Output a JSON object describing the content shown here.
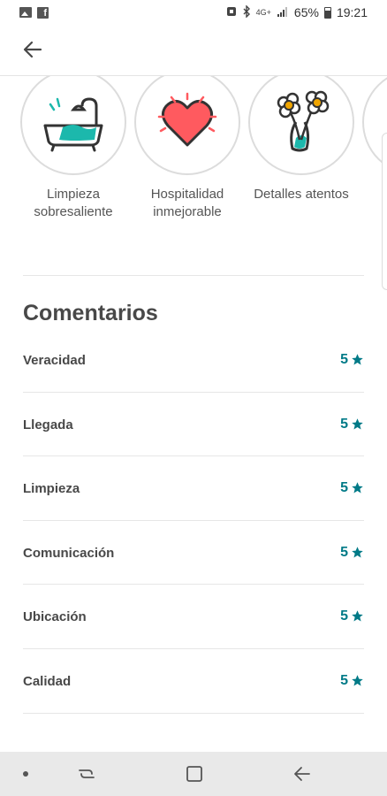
{
  "status_bar": {
    "network": "4G+",
    "battery": "65%",
    "time": "19:21"
  },
  "header": {
    "back_icon": "back-arrow-icon"
  },
  "highlights": [
    {
      "label": "Limpieza sobresaliente",
      "icon": "bathtub-icon"
    },
    {
      "label": "Hospitalidad inmejorable",
      "icon": "heart-icon"
    },
    {
      "label": "Detalles atentos",
      "icon": "flowers-vase-icon"
    }
  ],
  "comments": {
    "title": "Comentarios",
    "accent": "#007a87",
    "items": [
      {
        "label": "Veracidad",
        "value": "5"
      },
      {
        "label": "Llegada",
        "value": "5"
      },
      {
        "label": "Limpieza",
        "value": "5"
      },
      {
        "label": "Comunicación",
        "value": "5"
      },
      {
        "label": "Ubicación",
        "value": "5"
      },
      {
        "label": "Calidad",
        "value": "5"
      }
    ]
  }
}
